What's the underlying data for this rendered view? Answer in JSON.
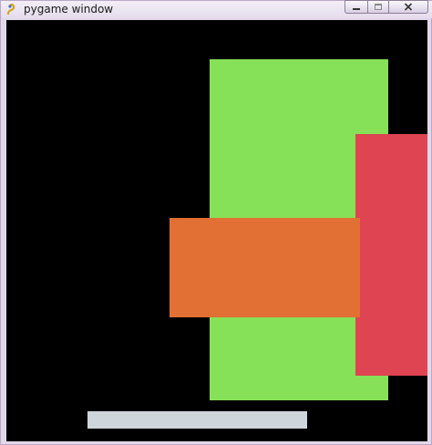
{
  "window": {
    "title": "pygame window",
    "controls": {
      "minimize_icon": "minimize-icon",
      "maximize_icon": "maximize-icon",
      "close_icon": "close-icon"
    }
  },
  "canvas": {
    "background_color": "#000000",
    "shapes": [
      {
        "name": "green-rectangle",
        "color": "#86e058"
      },
      {
        "name": "red-rectangle",
        "color": "#de4451"
      },
      {
        "name": "orange-rectangle",
        "color": "#e27034"
      },
      {
        "name": "paddle-bar",
        "color": "#ced6db"
      }
    ]
  }
}
